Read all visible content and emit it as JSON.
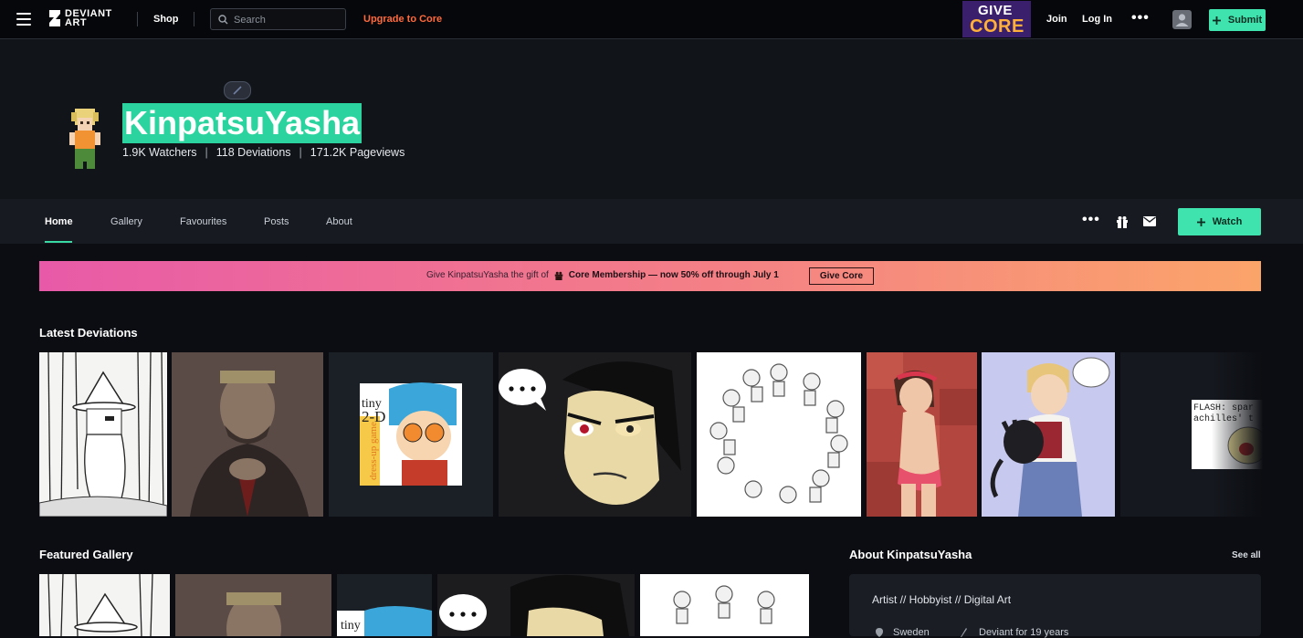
{
  "topbar": {
    "logo_text": "DEVIANT\nART",
    "shop": "Shop",
    "search_placeholder": "Search",
    "upgrade": "Upgrade to Core",
    "promo_line1": "GIVE",
    "promo_line2": "CORE",
    "join": "Join",
    "login": "Log In",
    "more": "•••",
    "submit": "Submit"
  },
  "profile": {
    "username": "KinpatsuYasha",
    "watchers": "1.9K Watchers",
    "deviations": "118 Deviations",
    "pageviews": "171.2K Pageviews",
    "separator": "|"
  },
  "profile_nav": {
    "tabs": [
      "Home",
      "Gallery",
      "Favourites",
      "Posts",
      "About"
    ],
    "more": "•••",
    "watch": "Watch"
  },
  "banner": {
    "text": "Give KinpatsuYasha the gift of",
    "bold": "Core Membership — now 50% off through July 1",
    "button": "Give Core"
  },
  "sections": {
    "latest": "Latest Deviations",
    "featured": "Featured Gallery",
    "about_title": "About KinpatsuYasha",
    "see_all": "See all"
  },
  "thumbs": {
    "tiny_line1": "tiny",
    "tiny_line2": "2-D",
    "tiny_vertical": "dress-up game",
    "flash_line1": "FLASH: spar",
    "flash_line2": "achilles' t"
  },
  "about": {
    "roles": "Artist  //  Hobbyist  //  Digital Art",
    "location": "Sweden",
    "member": "Deviant for 19 years"
  },
  "colors": {
    "accent": "#3ee3ad",
    "upgrade": "#ff6a3d",
    "background": "#0b0d12"
  }
}
